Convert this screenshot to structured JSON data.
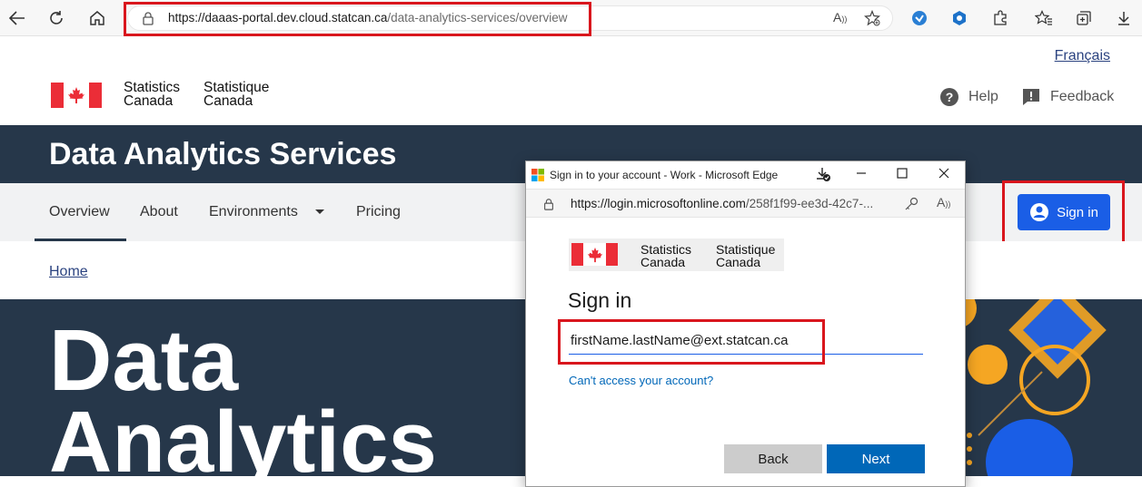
{
  "browser": {
    "url_host": "https://daaas-portal.dev.cloud.statcan.ca",
    "url_path": "/data-analytics-services/overview"
  },
  "header": {
    "language_link": "Français",
    "logo_en_line1": "Statistics",
    "logo_en_line2": "Canada",
    "logo_fr_line1": "Statistique",
    "logo_fr_line2": "Canada",
    "help_label": "Help",
    "feedback_label": "Feedback"
  },
  "band": {
    "title": "Data Analytics Services"
  },
  "menu": {
    "items": [
      "Overview",
      "About",
      "Environments",
      "Pricing"
    ],
    "sign_in_label": "Sign in"
  },
  "breadcrumb": {
    "home": "Home"
  },
  "hero": {
    "line1": "Data",
    "line2": "Analytics"
  },
  "popup": {
    "window_title": "Sign in to your account - Work - Microsoft Edge",
    "url_host": "https://login.microsoftonline.com",
    "url_path": "/258f1f99-ee3d-42c7-...",
    "logo_en_line1": "Statistics",
    "logo_en_line2": "Canada",
    "logo_fr_line1": "Statistique",
    "logo_fr_line2": "Canada",
    "heading": "Sign in",
    "email_value": "firstName.lastName@ext.statcan.ca",
    "cant_access": "Can't access your account?",
    "back_label": "Back",
    "next_label": "Next"
  },
  "colors": {
    "accent_blue": "#1a5ee6",
    "dark_navy": "#26374a",
    "highlight_red": "#d9161d",
    "canada_red": "#eb2d37",
    "ms_blue": "#0067b8"
  }
}
